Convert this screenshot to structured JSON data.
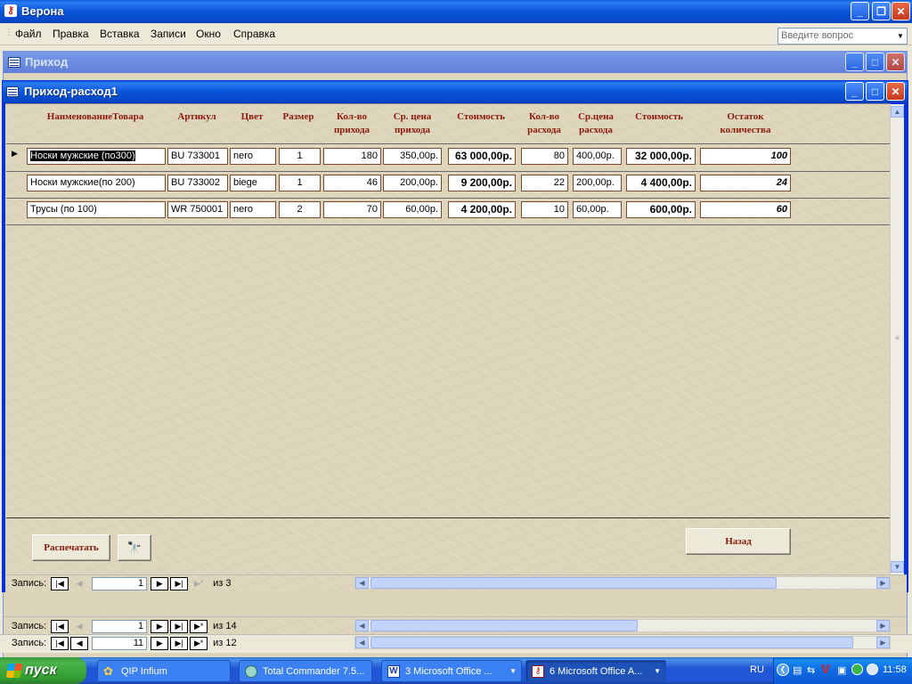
{
  "app": {
    "title": "Верона"
  },
  "menu": {
    "items": [
      "Файл",
      "Правка",
      "Вставка",
      "Записи",
      "Окно",
      "Справка"
    ],
    "ask_placeholder": "Введите вопрос"
  },
  "windows": {
    "prihod": "Приход",
    "prihod_rashod": "Приход-расход1"
  },
  "table": {
    "headers": {
      "name": "НаименованиеТовара",
      "article": "Артикул",
      "color": "Цвет",
      "size": "Размер",
      "qty_in_1": "Кол-во",
      "qty_in_2": "прихода",
      "price_in_1": "Ср. цена",
      "price_in_2": "прихода",
      "cost_in": "Стоимость",
      "qty_out_1": "Кол-во",
      "qty_out_2": "расхода",
      "price_out_1": "Ср.цена",
      "price_out_2": "расхода",
      "cost_out": "Стоимость",
      "rem_1": "Остаток",
      "rem_2": "количества"
    },
    "rows": [
      {
        "name": "Носки мужские (по300)",
        "article": "BU 733001",
        "color": "nero",
        "size": "1",
        "qty_in": "180",
        "price_in": "350,00р.",
        "cost_in": "63 000,00р.",
        "qty_out": "80",
        "price_out": "400,00р.",
        "cost_out": "32 000,00р.",
        "remain": "100"
      },
      {
        "name": "Носки мужские(по 200)",
        "article": "BU 733002",
        "color": "biege",
        "size": "1",
        "qty_in": "46",
        "price_in": "200,00р.",
        "cost_in": "9 200,00р.",
        "qty_out": "22",
        "price_out": "200,00р.",
        "cost_out": "4 400,00р.",
        "remain": "24"
      },
      {
        "name": "Трусы (по 100)",
        "article": "WR 750001",
        "color": "nero",
        "size": "2",
        "qty_in": "70",
        "price_in": "60,00р.",
        "cost_in": "4 200,00р.",
        "qty_out": "10",
        "price_out": "60,00р.",
        "cost_out": "600,00р.",
        "remain": "60"
      }
    ]
  },
  "buttons": {
    "print": "Распечатать",
    "back": "Назад"
  },
  "nav": {
    "label": "Запись:",
    "inner": {
      "current": "1",
      "of": "из  3"
    },
    "middle": {
      "current": "1",
      "of": "из  14"
    },
    "outer": {
      "current": "11",
      "of": "из  12"
    }
  },
  "taskbar": {
    "start": "пуск",
    "tasks": [
      "QIP Infium",
      "Total Commander 7.5...",
      "3 Microsoft Office ...",
      "6 Microsoft Office A..."
    ],
    "lang": "RU",
    "time": "11:58"
  }
}
